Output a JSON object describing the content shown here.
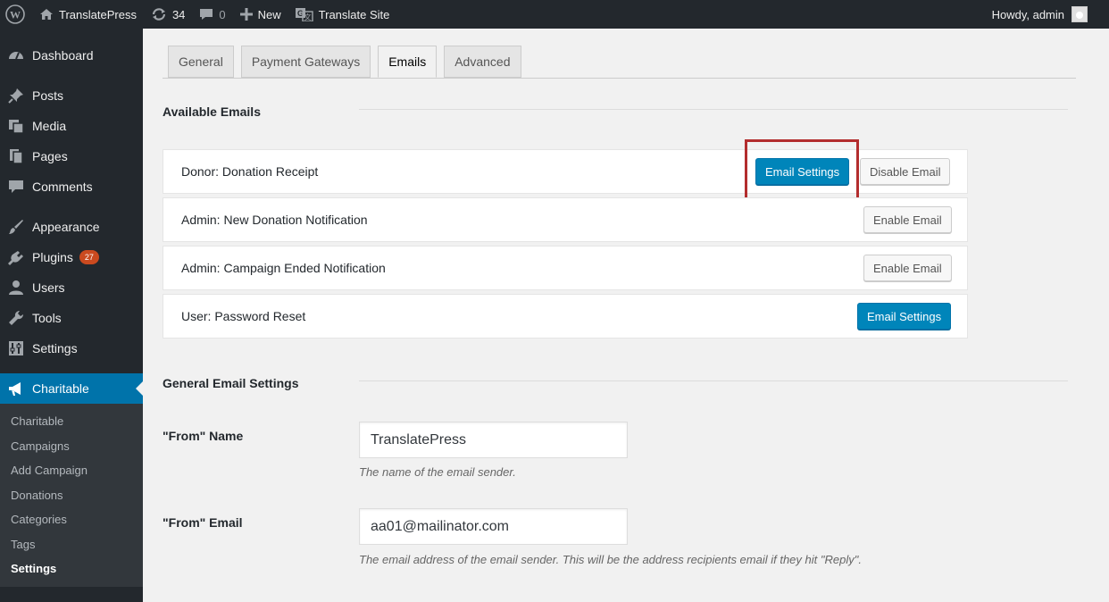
{
  "adminbar": {
    "site_name": "TranslatePress",
    "updates_count": "34",
    "comments_count": "0",
    "new_label": "New",
    "translate_label": "Translate Site",
    "howdy": "Howdy, admin"
  },
  "sidebar": {
    "items": [
      {
        "label": "Dashboard",
        "icon": "dashboard-icon"
      },
      {
        "label": "Posts",
        "icon": "pin-icon"
      },
      {
        "label": "Media",
        "icon": "media-icon"
      },
      {
        "label": "Pages",
        "icon": "pages-icon"
      },
      {
        "label": "Comments",
        "icon": "comment-icon"
      },
      {
        "label": "Appearance",
        "icon": "brush-icon"
      },
      {
        "label": "Plugins",
        "icon": "plug-icon",
        "badge": "27"
      },
      {
        "label": "Users",
        "icon": "user-icon"
      },
      {
        "label": "Tools",
        "icon": "wrench-icon"
      },
      {
        "label": "Settings",
        "icon": "settings-icon"
      },
      {
        "label": "Charitable",
        "icon": "megaphone-icon"
      }
    ],
    "submenu": [
      "Charitable",
      "Campaigns",
      "Add Campaign",
      "Donations",
      "Categories",
      "Tags",
      "Settings"
    ]
  },
  "tabs": [
    "General",
    "Payment Gateways",
    "Emails",
    "Advanced"
  ],
  "active_tab": "Emails",
  "available_emails": {
    "title": "Available Emails",
    "rows": [
      {
        "label": "Donor: Donation Receipt",
        "primary": "Email Settings",
        "secondary": "Disable Email"
      },
      {
        "label": "Admin: New Donation Notification",
        "secondary": "Enable Email"
      },
      {
        "label": "Admin: Campaign Ended Notification",
        "secondary": "Enable Email"
      },
      {
        "label": "User: Password Reset",
        "primary": "Email Settings"
      }
    ]
  },
  "general_settings": {
    "title": "General Email Settings",
    "from_name": {
      "label": "\"From\" Name",
      "value": "TranslatePress",
      "desc": "The name of the email sender."
    },
    "from_email": {
      "label": "\"From\" Email",
      "value": "aa01@mailinator.com",
      "desc": "The email address of the email sender. This will be the address recipients email if they hit \"Reply\"."
    }
  },
  "colors": {
    "accent": "#0073aa",
    "highlight": "#b32d2e",
    "adminbar": "#23282d"
  }
}
